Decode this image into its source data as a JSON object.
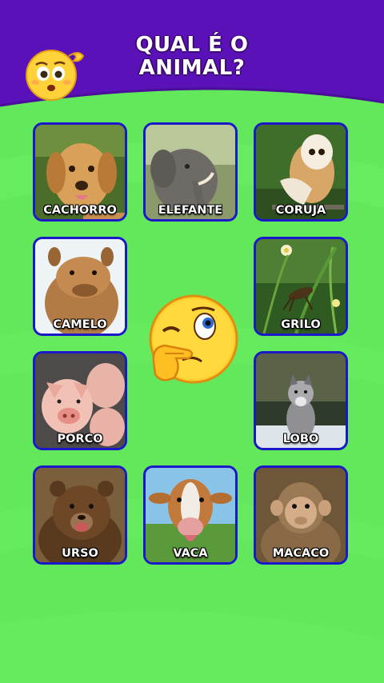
{
  "title_line1": "QUAL É O",
  "title_line2": "ANIMAL?",
  "colors": {
    "header": "#5a12b8",
    "background": "#62e85a",
    "card_border": "#1a18c9"
  },
  "icons": {
    "header_emoji": "confused-emoji-icon",
    "center_emoji": "thinking-wink-emoji-icon"
  },
  "animals": [
    {
      "label": "CACHORRO"
    },
    {
      "label": "ELEFANTE"
    },
    {
      "label": "CORUJA"
    },
    {
      "label": "CAMELO"
    },
    {
      "label": "GRILO"
    },
    {
      "label": "PORCO"
    },
    {
      "label": "LOBO"
    },
    {
      "label": "URSO"
    },
    {
      "label": "VACA"
    },
    {
      "label": "MACACO"
    }
  ]
}
